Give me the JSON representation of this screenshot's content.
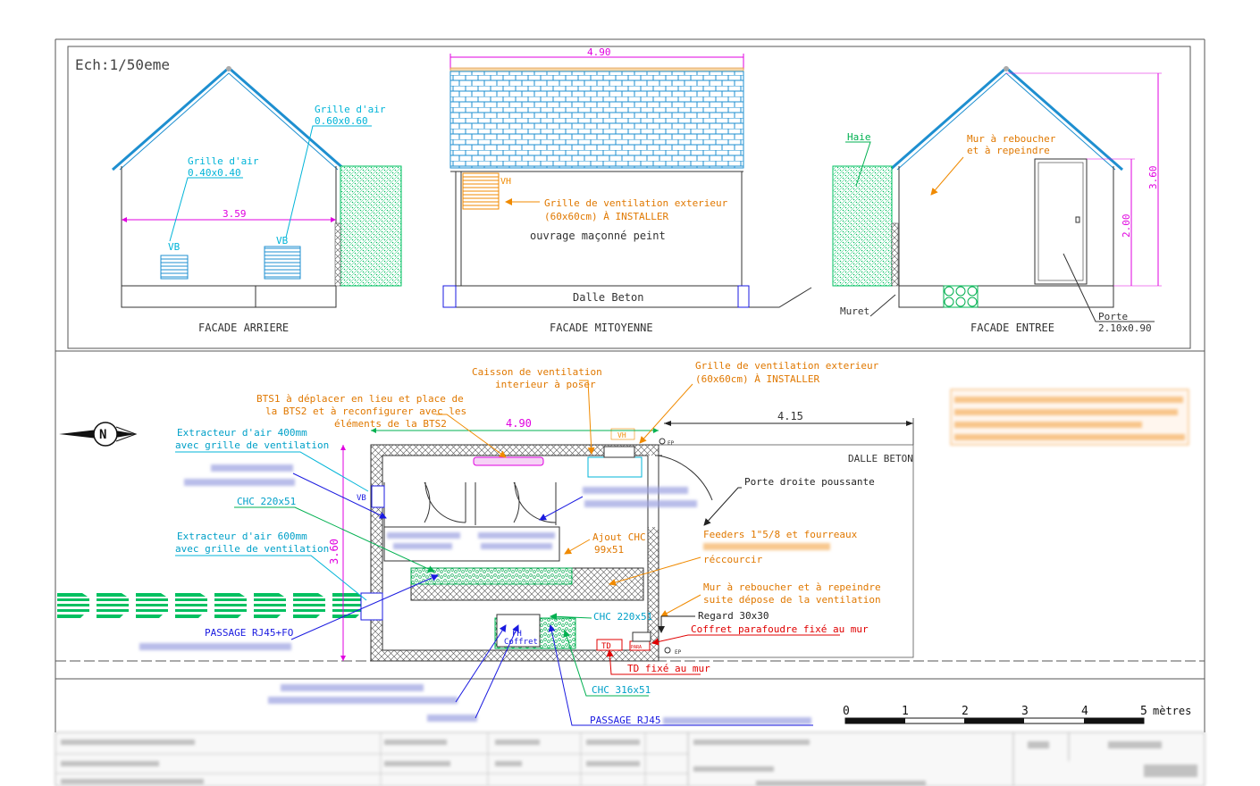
{
  "scale": "Ech:1/50eme",
  "elevations": {
    "rear": {
      "title": "FACADE ARRIERE",
      "width_dim": "3.59",
      "grille_large_title": "Grille d'air",
      "grille_large_size": "0.60x0.60",
      "grille_small_title": "Grille d'air",
      "grille_small_size": "0.40x0.40",
      "vb_left": "VB",
      "vb_right": "VB"
    },
    "side": {
      "title": "FACADE MITOYENNE",
      "width_dim": "4.90",
      "vh": "VH",
      "grille_line1": "Grille de ventilation exterieur",
      "grille_line2": "(60x60cm) À INSTALLER",
      "ouvrage": "ouvrage maçonné peint",
      "dalle": "Dalle Beton"
    },
    "entry": {
      "title": "FACADE ENTREE",
      "haie": "Haie",
      "mur_line1": "Mur à reboucher",
      "mur_line2": "et à repeindre",
      "muret": "Muret",
      "porte_label": "Porte",
      "porte_size": "2.10x0.90",
      "height_total": "3.60",
      "height_door": "2.00"
    }
  },
  "plan": {
    "width_dim": "4.90",
    "height_dim": "3.60",
    "offset_dim": "4.15",
    "dalle_beton": "DALLE BETON",
    "ep_top": "EP",
    "ep_bottom": "EP",
    "vh": "VH",
    "vb": "VB",
    "fh": "FH",
    "coffret": "Coffret",
    "td": "TD",
    "para": "PARA",
    "annotations": {
      "caisson_1": "Caisson de ventilation",
      "caisson_2": "interieur à poser",
      "grille_1": "Grille de ventilation exterieur",
      "grille_2": "(60x60cm) À INSTALLER",
      "bts_1": "BTS1 à déplacer en lieu et place de",
      "bts_2": "la BTS2 et à reconfigurer avec les",
      "bts_3": "éléments de la BTS2",
      "extr400_1": "Extracteur d'air 400mm",
      "extr400_2": "avec grille de ventilation",
      "chc_220_top": "CHC 220x51",
      "extr600_1": "Extracteur d'air 600mm",
      "extr600_2": "avec grille de ventilation",
      "passage_rj45": "PASSAGE RJ45+FO",
      "porte_droite": "Porte droite poussante",
      "feeders_1": "Feeders 1\"5/8 et fourreaux",
      "feeders_2": "réccourcir",
      "ajout_chc_1": "Ajout CHC",
      "ajout_chc_2": "99x51",
      "mur_rep_1": "Mur à reboucher et à repeindre",
      "mur_rep_2": "suite dépose de la ventilation",
      "regard": "Regard 30x30",
      "chc_220_bottom": "CHC 220x51",
      "coffret_para": "Coffret parafoudre fixé au mur",
      "td_fixe": "TD fixé au mur",
      "chc_316": "CHC 316x51",
      "passage_rj45_2": "PASSAGE RJ45"
    }
  },
  "scale_bar": {
    "ticks": [
      "0",
      "1",
      "2",
      "3",
      "4",
      "5"
    ],
    "unit": "mètres"
  },
  "colors": {
    "frame": "#555555",
    "roof": "#1e8fd0",
    "hedge": "#00c060",
    "dim": "#e000e0",
    "orange": "#f08a00",
    "blue": "#1a1ae0",
    "cyan": "#00b4d8",
    "red": "#e00000",
    "green": "#00b050"
  }
}
